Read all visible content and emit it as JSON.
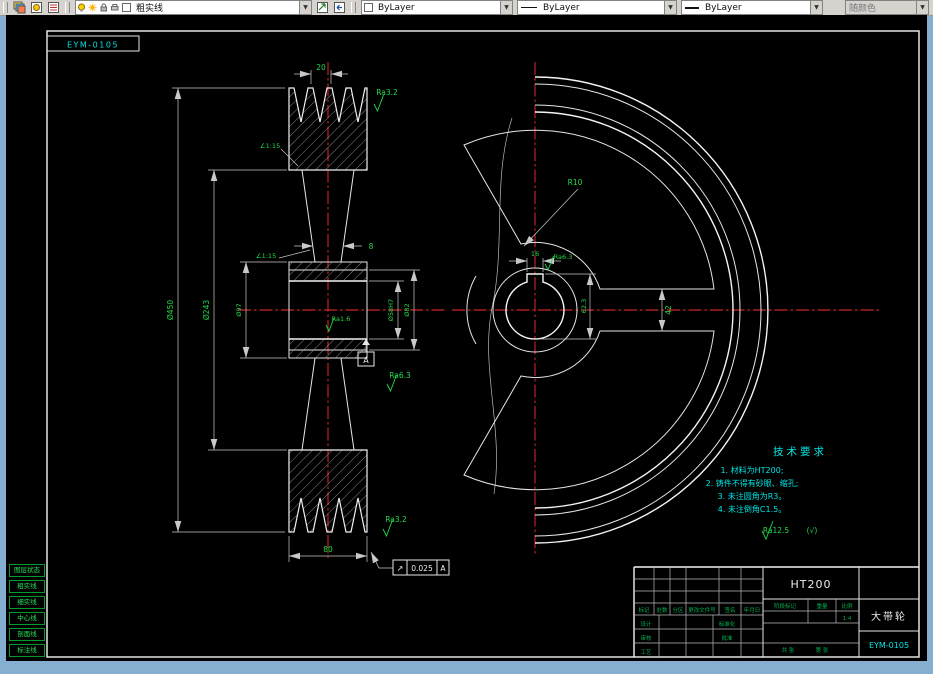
{
  "toolbar": {
    "layer_combo": {
      "value": "粗实线"
    },
    "color_combo": {
      "value": "ByLayer"
    },
    "linetype_combo": {
      "value": "ByLayer"
    },
    "lineweight_combo": {
      "value": "ByLayer"
    },
    "plot_style_combo": {
      "value": "随颜色"
    }
  },
  "sidebar": {
    "items": [
      {
        "label": "图层状态"
      },
      {
        "label": "粗实线"
      },
      {
        "label": "细实线"
      },
      {
        "label": "中心线"
      },
      {
        "label": "剖面线"
      },
      {
        "label": "标注线"
      }
    ]
  },
  "drawing": {
    "corner_label": "EYM-0105",
    "left_view": {
      "dim_groove_pitch": "20",
      "dim_outer_dia": "Ø450",
      "dim_groove_root_dia": "Ø243",
      "dim_hub_dia": "Ø97",
      "dim_boss_dia": "Ø82",
      "dim_bore": "Ø58H7",
      "dim_width": "80",
      "dim_web": "8",
      "taper_label_1": "∠1:15",
      "taper_label_2": "∠1:15",
      "rough_top": "Ra3.2",
      "rough_mid": "Ra6.3",
      "rough_bottom": "Ra3.2",
      "rough_bore": "Ra1.6",
      "datum_label": "A"
    },
    "tolerance_frame": {
      "symbol": "↗",
      "value": "0.025",
      "datum": "A"
    },
    "right_view": {
      "dim_fillet": "R10",
      "dim_arm_width": "42",
      "dim_keyway_depth": "62.3",
      "dim_keyway_width": "16",
      "rough_hub": "Ra6.3"
    },
    "tech_requirements": {
      "title": "技术要求",
      "items": [
        "1. 材料为HT200;",
        "2. 铸件不得有砂眼、缩孔;",
        "3. 未注圆角为R3。",
        "4. 未注倒角C1.5。"
      ],
      "rough_note": "Ra12.5",
      "rough_note_suffix": "(√)"
    },
    "title_block": {
      "material": "HT200",
      "part_name": "大带轮",
      "drawing_number": "EYM-0105",
      "labels": {
        "mark": "标记",
        "count": "处数",
        "zone": "分区",
        "file": "更改文件号",
        "sign": "签名",
        "date": "年月日",
        "design": "设计",
        "check": "审核",
        "process": "工艺",
        "standard": "标准化",
        "approve": "批准",
        "stage": "阶段标记",
        "weight": "重量",
        "scale": "比例"
      },
      "scale_value": "1:4",
      "sheet_total": "共 张",
      "sheet_number": "第 张"
    }
  },
  "colors": {
    "dim_text": "#21d94b",
    "tech_text": "#00e5e5",
    "centerline": "#ff2b2b",
    "geometry": "#ececec",
    "titleblock_label": "#00b050",
    "canvas_bg": "#000000",
    "window_frame": "#86aed0"
  }
}
